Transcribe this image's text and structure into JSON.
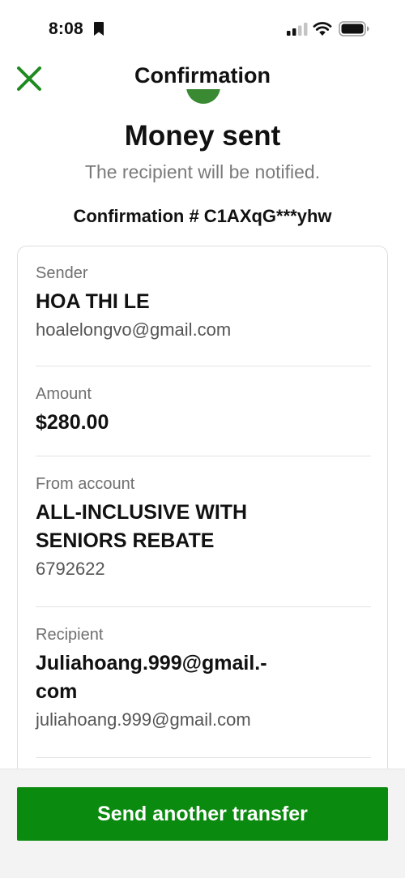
{
  "status_bar": {
    "time": "8:08"
  },
  "header": {
    "title": "Confirmation",
    "close_icon": "close-icon"
  },
  "main": {
    "title": "Money sent",
    "subtitle": "The recipient will be notified.",
    "confirmation": "Confirmation # C1AXqG***yhw"
  },
  "details": {
    "sender": {
      "label": "Sender",
      "name": "HOA THI LE",
      "email": "hoalelongvo@gmail.com"
    },
    "amount": {
      "label": "Amount",
      "value": "$280.00"
    },
    "from_account": {
      "label": "From account",
      "name_line1": "ALL-INCLUSIVE WITH",
      "name_line2": "SENIORS REBATE",
      "number": "6792622"
    },
    "recipient": {
      "label": "Recipient",
      "name_line1": "Juliahoang.999@gmail.-",
      "name_line2": "com",
      "email": "juliahoang.999@gmail.com"
    }
  },
  "footer": {
    "send_another_label": "Send another transfer"
  },
  "colors": {
    "accent": "#0a8a0e",
    "close_icon": "#1f8a1f"
  }
}
